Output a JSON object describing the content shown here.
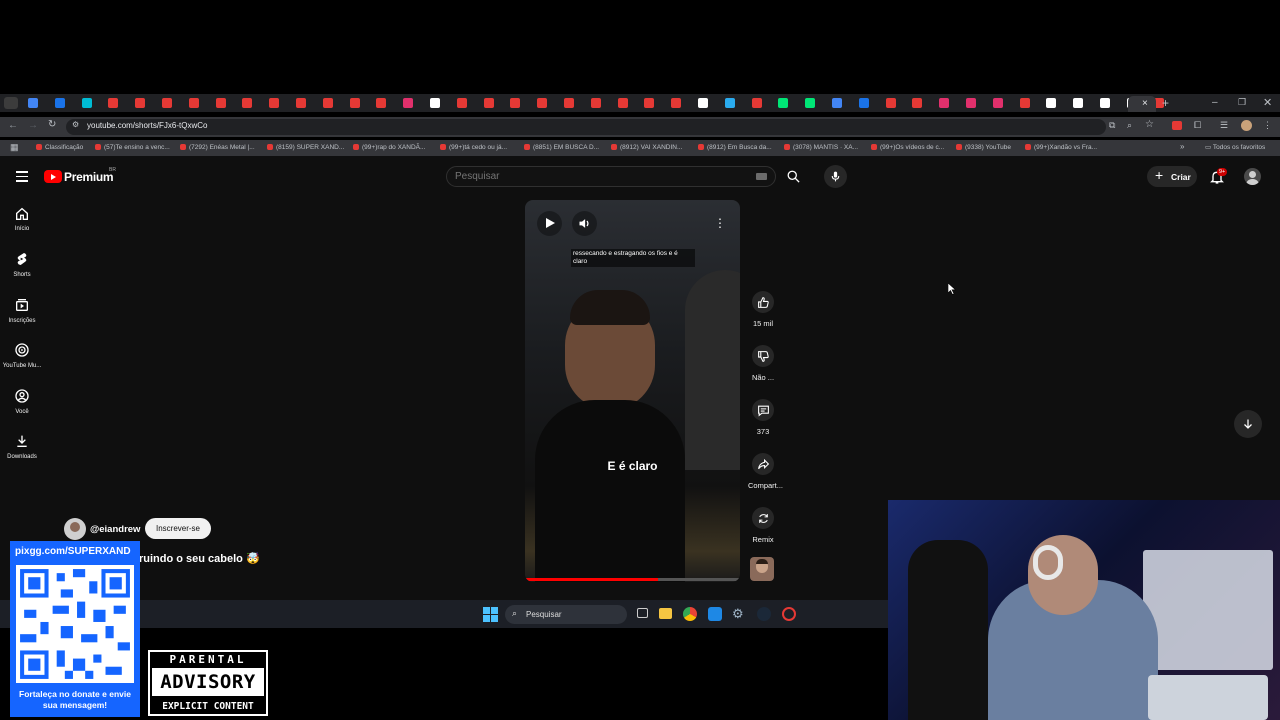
{
  "browser": {
    "url": "youtube.com/shorts/FJx6-tQxwCo",
    "bookmarks": [
      {
        "label": "Classificação"
      },
      {
        "label": "(57)Te ensino a venc..."
      },
      {
        "label": "(7292) Enéas Metal |..."
      },
      {
        "label": "(8159) SUPER XAND..."
      },
      {
        "label": "(99+)rap do XANDÃ..."
      },
      {
        "label": "(99+)tá cedo ou já..."
      },
      {
        "label": "(8851) EM BUSCA D..."
      },
      {
        "label": "(8912) VAI XANDIN..."
      },
      {
        "label": "(8912) Em Busca da..."
      },
      {
        "label": "(3078) MANTIS · XA..."
      },
      {
        "label": "(99+)Os vídeos de c..."
      },
      {
        "label": "(9338) YouTube"
      },
      {
        "label": "(99+)Xandão vs Fra..."
      }
    ],
    "all_bookmarks_label": "Todos os favoritos"
  },
  "youtube": {
    "logo_text": "Premium",
    "logo_region": "BR",
    "search_placeholder": "Pesquisar",
    "create_label": "Criar",
    "notification_count": "9+",
    "sidebar": [
      {
        "label": "Início",
        "icon": "home-icon"
      },
      {
        "label": "Shorts",
        "icon": "shorts-icon"
      },
      {
        "label": "Inscrições",
        "icon": "subscriptions-icon"
      },
      {
        "label": "YouTube Mu...",
        "icon": "youtube-music-icon"
      },
      {
        "label": "Você",
        "icon": "you-icon"
      },
      {
        "label": "Downloads",
        "icon": "download-icon"
      }
    ],
    "video": {
      "caption_top": "ressecando e estragando os fios e é claro",
      "caption_center": "E é claro",
      "channel": "@eiandrew",
      "subscribe_label": "Inscrever-se",
      "title": "Destruindo o seu cabelo 🤯",
      "title_visible": "ruindo o seu cabelo 🤯"
    },
    "actions": {
      "like": "15 mil",
      "dislike": "Não ...",
      "comments": "373",
      "share": "Compart...",
      "remix": "Remix"
    }
  },
  "taskbar": {
    "search_placeholder": "Pesquisar"
  },
  "overlay": {
    "pix_text": "pixgg.com/SUPERXAND",
    "donate_text": "Fortaleça no donate e envie sua mensagem!",
    "advisory_top": "PARENTAL",
    "advisory_mid": "ADVISORY",
    "advisory_bottom": "EXPLICIT CONTENT"
  },
  "colors": {
    "yt_red": "#ff0000",
    "yt_bg": "#0f0f0f",
    "pix_blue": "#1565ff"
  }
}
